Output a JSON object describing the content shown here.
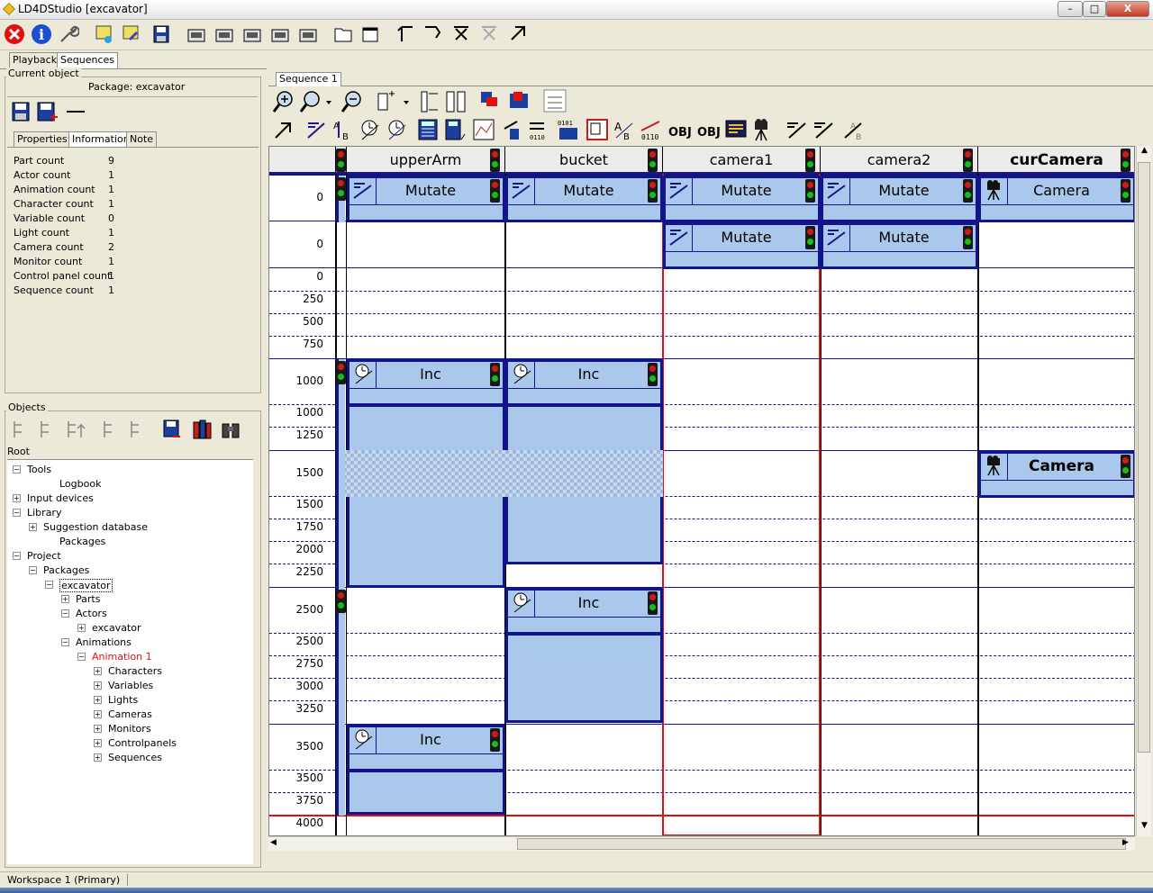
{
  "window": {
    "title": "LD4DStudio [excavator]",
    "controls": {
      "minimize": "–",
      "maximize": "□",
      "close": "X"
    }
  },
  "left_tabs": [
    "Playback",
    "Sequences"
  ],
  "current_object": {
    "group_label": "Current object",
    "package_label": "Package: excavator"
  },
  "info_tabs": [
    "Properties",
    "Information",
    "Note"
  ],
  "info_rows": [
    {
      "label": "Part count",
      "value": "9"
    },
    {
      "label": "Actor count",
      "value": "1"
    },
    {
      "label": "Animation count",
      "value": "1"
    },
    {
      "label": "Character count",
      "value": "1"
    },
    {
      "label": "Variable count",
      "value": "0"
    },
    {
      "label": "Light count",
      "value": "1"
    },
    {
      "label": "Camera count",
      "value": "2"
    },
    {
      "label": "Monitor count",
      "value": "1"
    },
    {
      "label": "Control panel count",
      "value": "1"
    },
    {
      "label": "Sequence count",
      "value": "1"
    }
  ],
  "objects": {
    "group_label": "Objects",
    "root_label": "Root"
  },
  "tree": [
    {
      "label": "Tools",
      "depth": 0,
      "expander": "−"
    },
    {
      "label": "Logbook",
      "depth": 2,
      "expander": ""
    },
    {
      "label": "Input devices",
      "depth": 0,
      "expander": "+"
    },
    {
      "label": "Library",
      "depth": 0,
      "expander": "−"
    },
    {
      "label": "Suggestion database",
      "depth": 1,
      "expander": "+"
    },
    {
      "label": "Packages",
      "depth": 2,
      "expander": ""
    },
    {
      "label": "Project",
      "depth": 0,
      "expander": "−"
    },
    {
      "label": "Packages",
      "depth": 1,
      "expander": "−"
    },
    {
      "label": "excavator",
      "depth": 2,
      "expander": "−"
    },
    {
      "label": "Parts",
      "depth": 3,
      "expander": "+"
    },
    {
      "label": "Actors",
      "depth": 3,
      "expander": "−"
    },
    {
      "label": "excavator",
      "depth": 4,
      "expander": "+"
    },
    {
      "label": "Animations",
      "depth": 3,
      "expander": "−"
    },
    {
      "label": "Animation 1",
      "depth": 4,
      "expander": "−",
      "highlight": true
    },
    {
      "label": "Characters",
      "depth": 5,
      "expander": "+"
    },
    {
      "label": "Variables",
      "depth": 5,
      "expander": "+"
    },
    {
      "label": "Lights",
      "depth": 5,
      "expander": "+"
    },
    {
      "label": "Cameras",
      "depth": 5,
      "expander": "+"
    },
    {
      "label": "Monitors",
      "depth": 5,
      "expander": "+"
    },
    {
      "label": "Controlpanels",
      "depth": 5,
      "expander": "+"
    },
    {
      "label": "Sequences",
      "depth": 5,
      "expander": "+"
    }
  ],
  "sequence_tab": "Sequence 1",
  "toolbar2_texts": [
    "OBJ",
    "OBJ",
    "0110",
    "0101",
    "AB"
  ],
  "columns": [
    "upperArm",
    "bucket",
    "camera1",
    "camera2",
    "curCamera"
  ],
  "time_labels": [
    "0",
    "0",
    "0",
    "250",
    "500",
    "750",
    "1000",
    "1000",
    "1250",
    "1500",
    "1500",
    "1750",
    "2000",
    "2250",
    "2500",
    "2500",
    "2750",
    "3000",
    "3250",
    "3500",
    "3500",
    "3750",
    "4000"
  ],
  "blocks": [
    {
      "label": "Mutate",
      "icon": "mutate"
    },
    {
      "label": "Mutate",
      "icon": "mutate"
    },
    {
      "label": "Mutate",
      "icon": "mutate"
    },
    {
      "label": "Mutate",
      "icon": "mutate"
    },
    {
      "label": "Camera",
      "icon": "camera"
    },
    {
      "label": "Mutate",
      "icon": "mutate"
    },
    {
      "label": "Mutate",
      "icon": "mutate"
    },
    {
      "label": "Inc",
      "icon": "clock"
    },
    {
      "label": "Inc",
      "icon": "clock"
    },
    {
      "label": "Camera",
      "icon": "camera",
      "bold": true
    },
    {
      "label": "Inc",
      "icon": "clock"
    },
    {
      "label": "Inc",
      "icon": "clock"
    }
  ],
  "statusbar": {
    "workspace": "Workspace 1 (Primary)"
  },
  "colors": {
    "block_fill": "#a9c8ec",
    "block_border": "#14148a",
    "cursor_line": "#e01010",
    "highlight_text": "#e01010"
  }
}
